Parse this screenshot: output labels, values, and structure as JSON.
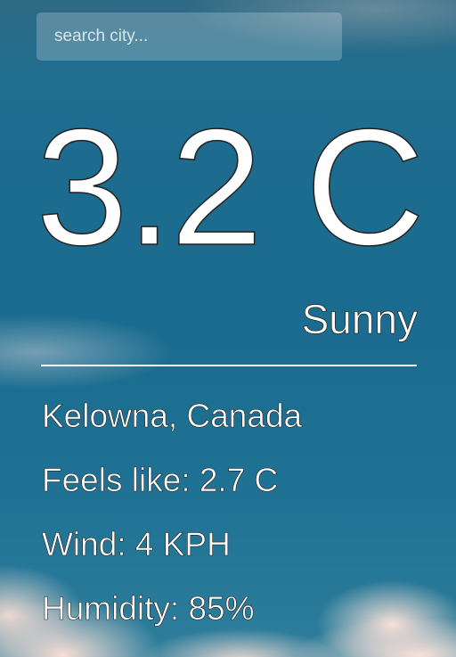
{
  "search": {
    "placeholder": "search city..."
  },
  "weather": {
    "temperature": "3.2 C",
    "condition": "Sunny",
    "location": "Kelowna, Canada",
    "feels_like": "Feels like: 2.7 C",
    "wind": "Wind: 4 KPH",
    "humidity": "Humidity: 85%"
  }
}
